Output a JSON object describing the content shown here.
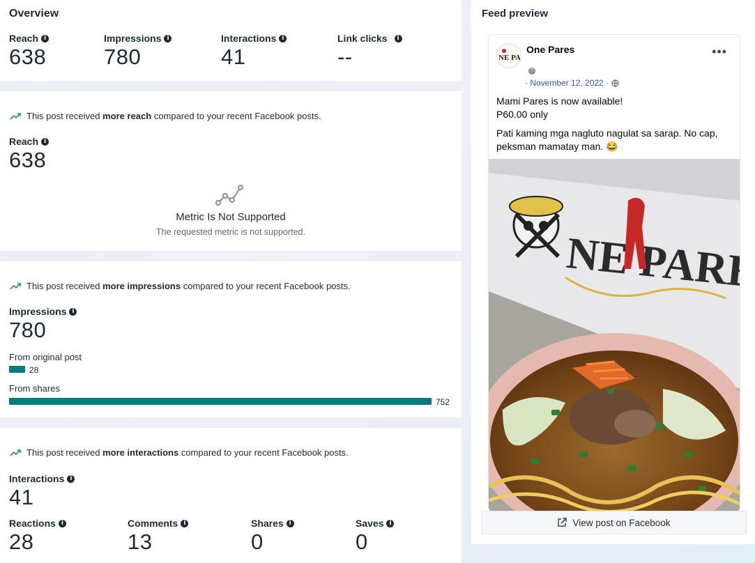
{
  "overview": {
    "title": "Overview",
    "metrics": [
      {
        "label": "Reach",
        "value": "638"
      },
      {
        "label": "Impressions",
        "value": "780"
      },
      {
        "label": "Interactions",
        "value": "41"
      },
      {
        "label": "Link clicks",
        "value": "--"
      }
    ]
  },
  "reach_section": {
    "trend_pre": "This post received ",
    "trend_bold": "more reach",
    "trend_post": " compared to your recent Facebook posts.",
    "label": "Reach",
    "value": "638",
    "not_supported_title": "Metric Is Not Supported",
    "not_supported_sub": "The requested metric is not supported."
  },
  "impressions_section": {
    "trend_pre": "This post received ",
    "trend_bold": "more impressions",
    "trend_post": " compared to your recent Facebook posts.",
    "label": "Impressions",
    "value": "780",
    "breakdown": [
      {
        "label": "From original post",
        "value": 28
      },
      {
        "label": "From shares",
        "value": 752
      }
    ]
  },
  "interactions_section": {
    "trend_pre": "This post received ",
    "trend_bold": "more interactions",
    "trend_post": " compared to your recent Facebook posts.",
    "label": "Interactions",
    "value": "41",
    "metrics": [
      {
        "label": "Reactions",
        "value": "28"
      },
      {
        "label": "Comments",
        "value": "13"
      },
      {
        "label": "Shares",
        "value": "0"
      },
      {
        "label": "Saves",
        "value": "0"
      }
    ]
  },
  "feed_preview": {
    "title": "Feed preview",
    "page_name": "One Pares",
    "avatar_text": "NE PA",
    "date": "· November 12, 2022 ·",
    "text_line1": "Mami Pares is now available!",
    "text_line2": "P60.00 only",
    "text_line3": "Pati kaming mga nagluto nagulat sa sarap. No cap, peksman mamatay man. 😂",
    "banner_text": "NE PARES",
    "view_post_label": "View post on Facebook"
  },
  "colors": {
    "bar": "#067a7e",
    "trend": "#2e8a5f",
    "link": "#385898"
  }
}
